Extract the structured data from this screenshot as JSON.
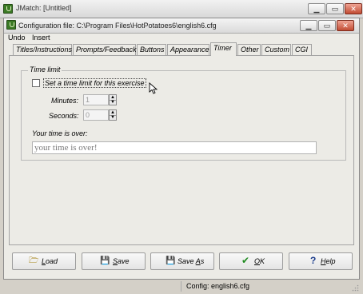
{
  "outer_window": {
    "title": "JMatch: [Untitled]"
  },
  "dialog": {
    "title": "Configuration file: C:\\Program Files\\HotPotatoes6\\english6.cfg",
    "menu": [
      "Undo",
      "Insert"
    ],
    "tabs": [
      "Titles/Instructions",
      "Prompts/Feedback",
      "Buttons",
      "Appearance",
      "Timer",
      "Other",
      "Custom",
      "CGI"
    ],
    "active_tab": "Timer",
    "timer": {
      "group_title": "Time limit",
      "checkbox_label": "Set a time limit for this exercise",
      "checkbox_checked": false,
      "minutes_label": "Minutes:",
      "minutes_value": "1",
      "seconds_label": "Seconds:",
      "seconds_value": "0",
      "over_label": "Your time is over:",
      "over_value": "your time is over!"
    },
    "buttons": {
      "load": {
        "pre": "",
        "key": "L",
        "post": "oad"
      },
      "save": {
        "pre": "",
        "key": "S",
        "post": "ave"
      },
      "save_as": {
        "pre": "Save ",
        "key": "A",
        "post": "s"
      },
      "ok": {
        "pre": "",
        "key": "O",
        "post": "K"
      },
      "help": {
        "pre": "",
        "key": "H",
        "post": "elp"
      }
    }
  },
  "statusbar": {
    "text": "Config: english6.cfg"
  },
  "colors": {
    "ok_check": "#1e8a1e",
    "save_disk": "#1a1a2e",
    "help_icon": "#1b3c8c",
    "load_folder": "#e1c25a",
    "app_icon": "#3b7a25"
  }
}
